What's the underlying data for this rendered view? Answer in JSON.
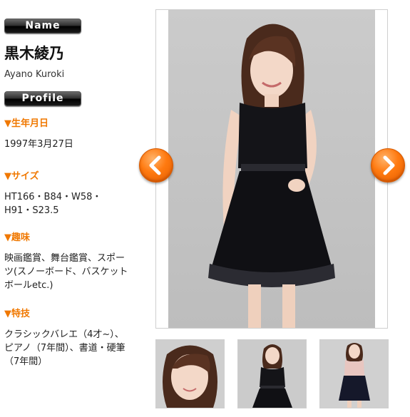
{
  "profile": {
    "name_label": "Name",
    "name_jp": "黒木綾乃",
    "name_en": "Ayano Kuroki",
    "profile_label": "Profile",
    "items": [
      {
        "heading": "▼生年月日",
        "value": "1997年3月27日"
      },
      {
        "heading": "▼サイズ",
        "value": "HT166・B84・W58・H91・S23.5"
      },
      {
        "heading": "▼趣味",
        "value": "映画鑑賞、舞台鑑賞、スポーツ(スノーボード、バスケットボールetc.)"
      },
      {
        "heading": "▼特技",
        "value": "クラシックバレエ（4才~）、ピアノ（7年間）、書道・硬筆（7年間）"
      }
    ]
  },
  "gallery": {
    "thumbnails": [
      "close-up portrait",
      "black dress standing",
      "pink top dark skirt standing"
    ]
  },
  "colors": {
    "accent": "#f07800",
    "arrow": "#ff7a10",
    "pill": "#2a2a2a"
  }
}
